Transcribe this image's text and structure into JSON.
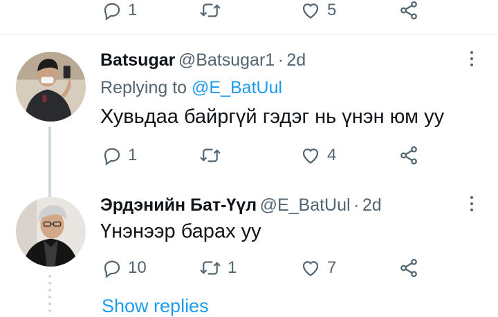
{
  "top_actions": {
    "reply_count": "1",
    "retweet_count": "",
    "like_count": "5"
  },
  "tweet1": {
    "display_name": "Batsugar",
    "handle": "@Batsugar1",
    "separator": "·",
    "time": "2d",
    "replying_prefix": "Replying to ",
    "replying_handle": "@E_BatUul",
    "text": "Хувьдаа байргүй гэдэг нь үнэн юм уу",
    "reply_count": "1",
    "retweet_count": "",
    "like_count": "4"
  },
  "tweet2": {
    "display_name": "Эрдэнийн Бат-Үүл",
    "handle": "@E_BatUul",
    "separator": "·",
    "time": "2d",
    "text": "Үнэнээр барах уу",
    "reply_count": "10",
    "retweet_count": "1",
    "like_count": "7"
  },
  "show_replies": "Show replies",
  "icons": {
    "reply": "reply-icon",
    "retweet": "retweet-icon",
    "like": "heart-icon",
    "share": "share-icon",
    "more": "more-options-icon"
  },
  "colors": {
    "text_primary": "#0f1419",
    "text_secondary": "#536471",
    "link": "#1d9bf0",
    "divider": "#eff3f4",
    "thread_line": "#cfd9de"
  }
}
